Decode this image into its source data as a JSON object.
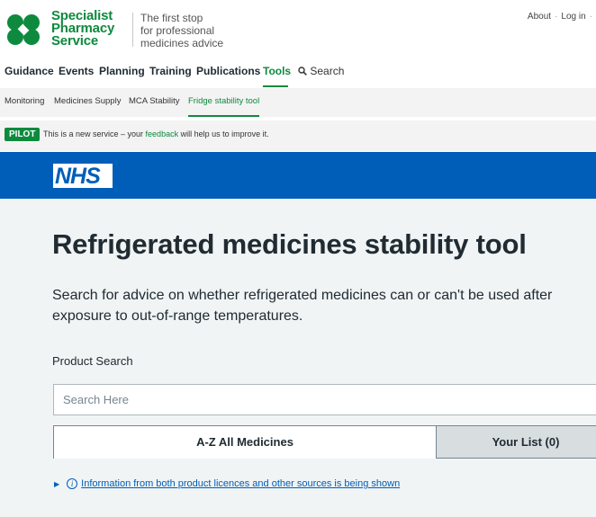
{
  "header": {
    "logo_line1": "Specialist",
    "logo_line2": "Pharmacy",
    "logo_line3": "Service",
    "tagline1": "The first stop",
    "tagline2": "for professional",
    "tagline3": "medicines advice",
    "about_label": "About",
    "login_label": "Log in"
  },
  "main_nav": {
    "guidance": "Guidance",
    "events": "Events",
    "planning": "Planning",
    "training": "Training",
    "publications": "Publications",
    "tools": "Tools",
    "search": "Search"
  },
  "sub_nav": {
    "monitoring": "Monitoring",
    "medicines_supply": "Medicines Supply",
    "mca_stability": "MCA Stability",
    "fridge_tool": "Fridge stability tool"
  },
  "pilot": {
    "badge": "PILOT",
    "msg_before": "This is a new service – your ",
    "link": "feedback",
    "msg_after": " will help us to improve it."
  },
  "nhs": {
    "logo": "NHS"
  },
  "main": {
    "title": "Refrigerated medicines stability tool",
    "lead": "Search for advice on whether refrigerated medicines can or can't be used after exposure to out-of-range temperatures.",
    "search_label": "Product Search",
    "search_placeholder": "Search Here",
    "tab_all": "A-Z All Medicines",
    "tab_list": "Your List (0)",
    "info_text": "Information from both product licences and other sources is being shown"
  },
  "colors": {
    "brand_green": "#0d8a3e",
    "nhs_blue": "#005eb8",
    "content_bg": "#f0f4f5"
  }
}
